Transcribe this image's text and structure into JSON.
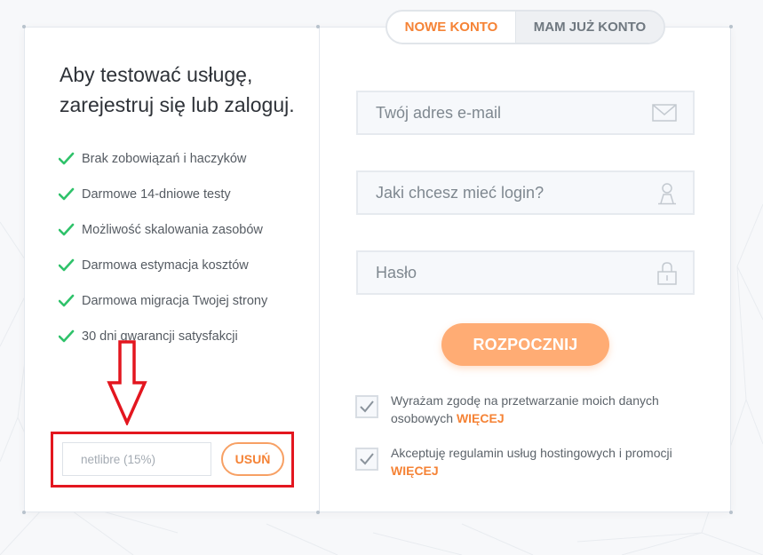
{
  "left": {
    "headline": "Aby testować usługę, zarejestruj się lub zaloguj.",
    "features": [
      "Brak zobowiązań i haczyków",
      "Darmowe 14-dniowe testy",
      "Możliwość skalowania zasobów",
      "Darmowa estymacja kosztów",
      "Darmowa migracja Twojej strony",
      "30 dni gwarancji satysfakcji"
    ],
    "promo": {
      "code_value": "netlibre (15%)",
      "remove_label": "USUŃ"
    }
  },
  "tabs": {
    "new_account": "NOWE KONTO",
    "existing_account": "MAM JUŻ KONTO"
  },
  "form": {
    "email_placeholder": "Twój adres e-mail",
    "login_placeholder": "Jaki chcesz mieć login?",
    "password_placeholder": "Hasło",
    "submit_label": "ROZPOCZNIJ",
    "consents": [
      {
        "text": "Wyrażam zgodę na przetwarzanie moich danych osobowych",
        "more": "WIĘCEJ",
        "checked": true
      },
      {
        "text": "Akceptuję regulamin usług hostingowych i promocji",
        "more": "WIĘCEJ",
        "checked": true
      }
    ]
  },
  "icons": {
    "email": "envelope-icon",
    "login": "user-icon",
    "password": "lock-icon",
    "feature": "check-icon"
  },
  "colors": {
    "accent": "#f58336",
    "button": "#ffac74",
    "check": "#2fc26a",
    "highlight": "#e3161f"
  }
}
